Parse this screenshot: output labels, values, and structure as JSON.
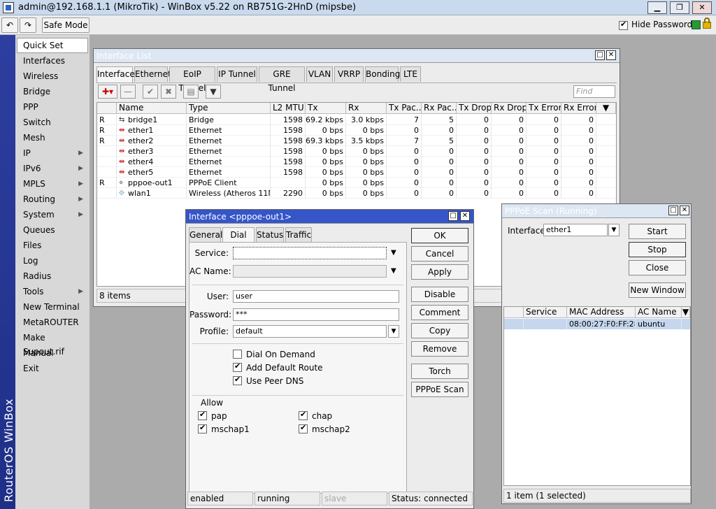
{
  "app": {
    "title": "admin@192.168.1.1 (MikroTik) - WinBox v5.22 on RB751G-2HnD (mipsbe)",
    "vertical_brand": "RouterOS WinBox"
  },
  "window_controls": {
    "minimize": "▁",
    "maximize": "❐",
    "close": "✕"
  },
  "toolbar": {
    "undo": "↶",
    "redo": "↷",
    "safe_mode": "Safe Mode",
    "hide_passwords": "Hide Passwords"
  },
  "menu": [
    {
      "label": "Quick Set",
      "sub": false,
      "sel": true
    },
    {
      "label": "Interfaces",
      "sub": false
    },
    {
      "label": "Wireless",
      "sub": false
    },
    {
      "label": "Bridge",
      "sub": false
    },
    {
      "label": "PPP",
      "sub": false
    },
    {
      "label": "Switch",
      "sub": false
    },
    {
      "label": "Mesh",
      "sub": false
    },
    {
      "label": "IP",
      "sub": true
    },
    {
      "label": "IPv6",
      "sub": true
    },
    {
      "label": "MPLS",
      "sub": true
    },
    {
      "label": "Routing",
      "sub": true
    },
    {
      "label": "System",
      "sub": true
    },
    {
      "label": "Queues",
      "sub": false
    },
    {
      "label": "Files",
      "sub": false
    },
    {
      "label": "Log",
      "sub": false
    },
    {
      "label": "Radius",
      "sub": false
    },
    {
      "label": "Tools",
      "sub": true
    },
    {
      "label": "New Terminal",
      "sub": false
    },
    {
      "label": "MetaROUTER",
      "sub": false
    },
    {
      "label": "Make Supout.rif",
      "sub": false
    },
    {
      "label": "Manual",
      "sub": false
    },
    {
      "label": "Exit",
      "sub": false
    }
  ],
  "iface_list": {
    "title": "Interface List",
    "tabs": [
      "Interface",
      "Ethernet",
      "EoIP Tunnel",
      "IP Tunnel",
      "GRE Tunnel",
      "VLAN",
      "VRRP",
      "Bonding",
      "LTE"
    ],
    "find_placeholder": "Find",
    "columns": [
      "",
      "Name",
      "Type",
      "L2 MTU",
      "Tx",
      "Rx",
      "Tx Pac...",
      "Rx Pac...",
      "Tx Drops",
      "Rx Drops",
      "Tx Errors",
      "Rx Errors"
    ],
    "rows": [
      [
        "R",
        "bridge1",
        "Bridge",
        "1598",
        "69.2 kbps",
        "3.0 kbps",
        "7",
        "5",
        "0",
        "0",
        "0",
        "0"
      ],
      [
        "R",
        "ether1",
        "Ethernet",
        "1598",
        "0 bps",
        "0 bps",
        "0",
        "0",
        "0",
        "0",
        "0",
        "0"
      ],
      [
        "R",
        "ether2",
        "Ethernet",
        "1598",
        "69.3 kbps",
        "3.5 kbps",
        "7",
        "5",
        "0",
        "0",
        "0",
        "0"
      ],
      [
        "",
        "ether3",
        "Ethernet",
        "1598",
        "0 bps",
        "0 bps",
        "0",
        "0",
        "0",
        "0",
        "0",
        "0"
      ],
      [
        "",
        "ether4",
        "Ethernet",
        "1598",
        "0 bps",
        "0 bps",
        "0",
        "0",
        "0",
        "0",
        "0",
        "0"
      ],
      [
        "",
        "ether5",
        "Ethernet",
        "1598",
        "0 bps",
        "0 bps",
        "0",
        "0",
        "0",
        "0",
        "0",
        "0"
      ],
      [
        "R",
        "pppoe-out1",
        "PPPoE Client",
        "",
        "0 bps",
        "0 bps",
        "0",
        "0",
        "0",
        "0",
        "0",
        "0"
      ],
      [
        "",
        "wlan1",
        "Wireless (Atheros 11N)",
        "2290",
        "0 bps",
        "0 bps",
        "0",
        "0",
        "0",
        "0",
        "0",
        "0"
      ]
    ],
    "row_icons": [
      "bridge",
      "eth",
      "eth",
      "eth",
      "eth",
      "eth",
      "ppp",
      "wlan"
    ],
    "count": "8 items"
  },
  "pppoe_dialog": {
    "title": "Interface <pppoe-out1>",
    "tabs": [
      "General",
      "Dial Out",
      "Status",
      "Traffic"
    ],
    "labels": {
      "service": "Service:",
      "ac_name": "AC Name:",
      "user": "User:",
      "password": "Password:",
      "profile": "Profile:"
    },
    "values": {
      "service": "",
      "ac_name": "",
      "user": "user",
      "password": "***",
      "profile": "default"
    },
    "checks": [
      {
        "label": "Dial On Demand",
        "on": false
      },
      {
        "label": "Add Default Route",
        "on": true
      },
      {
        "label": "Use Peer DNS",
        "on": true
      }
    ],
    "allow_title": "Allow",
    "allow": [
      {
        "label": "pap",
        "on": true
      },
      {
        "label": "chap",
        "on": true
      },
      {
        "label": "mschap1",
        "on": true
      },
      {
        "label": "mschap2",
        "on": true
      }
    ],
    "buttons": [
      "OK",
      "Cancel",
      "Apply",
      "Disable",
      "Comment",
      "Copy",
      "Remove",
      "Torch",
      "PPPoE Scan"
    ],
    "status": [
      "enabled",
      "running",
      "slave",
      "Status: connected"
    ]
  },
  "pppoe_scan": {
    "title": "PPPoE Scan (Running)",
    "interface_label": "Interface:",
    "interface_value": "ether1",
    "buttons": [
      "Start",
      "Stop",
      "Close",
      "New Window"
    ],
    "columns": [
      "",
      "Service",
      "MAC Address",
      "AC Name"
    ],
    "rows": [
      [
        "",
        "",
        "08:00:27:F0:FF:28",
        "ubuntu"
      ]
    ],
    "count": "1 item (1 selected)"
  },
  "colors": {
    "accent": "#2d3ea0",
    "lock": "#e4b400",
    "status_green": "#2a9a2a",
    "selection": "#c5d6ee"
  }
}
